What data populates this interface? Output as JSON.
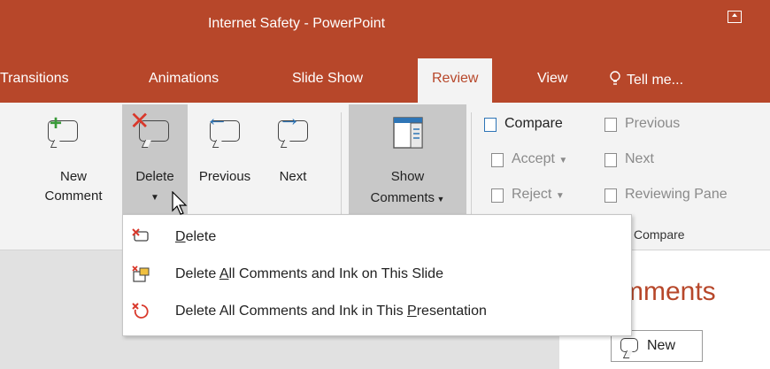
{
  "window": {
    "title": "Internet Safety - PowerPoint"
  },
  "tabs": [
    "Transitions",
    "Animations",
    "Slide Show",
    "Review",
    "View",
    "Tell me..."
  ],
  "ribbon": {
    "new_comment": [
      "New",
      "Comment"
    ],
    "delete": "Delete",
    "previous": "Previous",
    "next": "Next",
    "show_comments": [
      "Show",
      "Comments"
    ],
    "compare_group": {
      "compare": "Compare",
      "accept": "Accept",
      "reject": "Reject",
      "previous": "Previous",
      "next": "Next",
      "reviewing_pane": "Reviewing Pane",
      "group_label": "Compare"
    }
  },
  "dropdown": {
    "items": [
      {
        "label": "Delete",
        "accel": "D",
        "icon": "delete-comment-icon"
      },
      {
        "label": "Delete All Comments and Ink on This Slide",
        "accel": "A",
        "icon": "delete-all-slide-icon"
      },
      {
        "label": "Delete All Comments and Ink in This Presentation",
        "accel": "P",
        "icon": "delete-all-presentation-icon"
      }
    ]
  },
  "comments_pane": {
    "heading": "mments",
    "new_button": "New"
  },
  "colors": {
    "accent": "#b7472a",
    "ribbon": "#f3f3f3"
  }
}
